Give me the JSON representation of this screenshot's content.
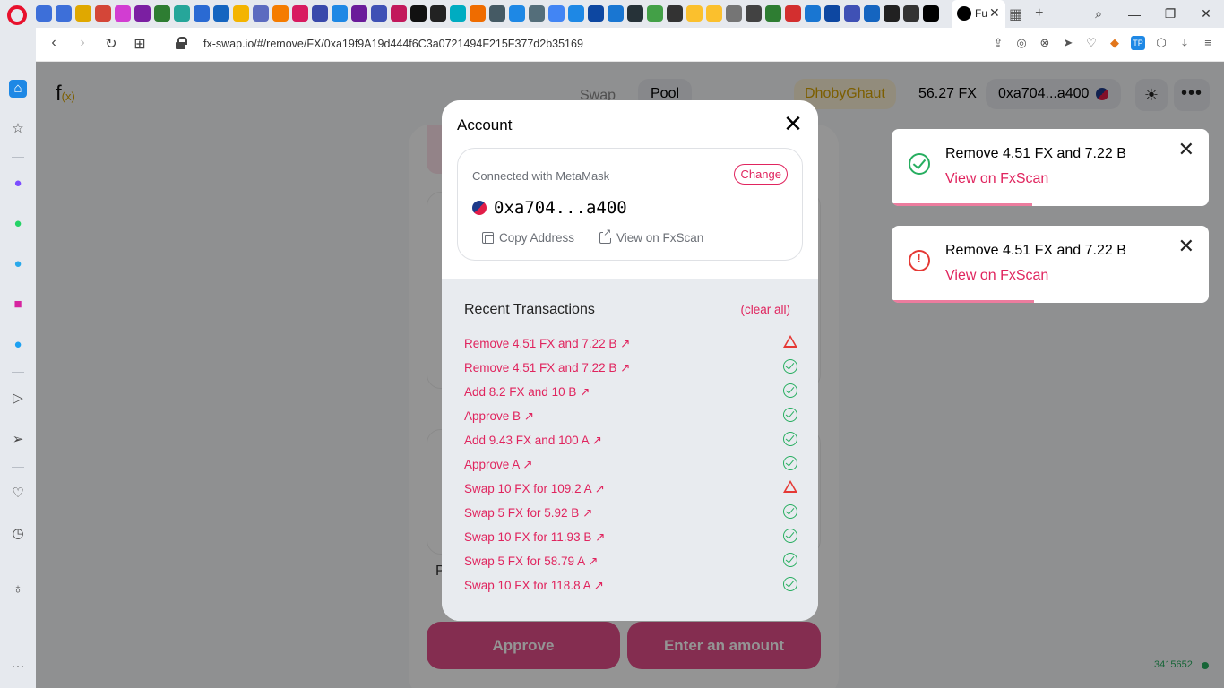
{
  "browser": {
    "active_tab_title": "Fu",
    "url": "fx-swap.io/#/remove/FX/0xa19f9A19d444f6C3a0721494F215F377d2b35169",
    "tab_favicon_colors": [
      "#3d6fd9",
      "#3d6fd9",
      "#e0a800",
      "#d44638",
      "#d23dd2",
      "#7b1fa2",
      "#2e7d32",
      "#26a69a",
      "#2a6ad3",
      "#1565c0",
      "#f4b400",
      "#5c6bc0",
      "#f57c00",
      "#d81b60",
      "#3949ab",
      "#1e88e5",
      "#6a1b9a",
      "#3f51b5",
      "#c2185b",
      "#111111",
      "#222222",
      "#00acc1",
      "#ef6c00",
      "#455a64",
      "#1e88e5",
      "#546e7a",
      "#4285f4",
      "#1e88e5",
      "#0d47a1",
      "#1976d2",
      "#263238",
      "#43a047",
      "#333333",
      "#fbc02d",
      "#fbc02d",
      "#757575",
      "#424242",
      "#2e7d32",
      "#d32f2f",
      "#1976d2",
      "#0d47a1",
      "#3f51b5",
      "#1565c0",
      "#212121",
      "#333333",
      "#000000"
    ]
  },
  "app": {
    "logo_text": "f",
    "logo_sub": "(x)",
    "nav": {
      "swap": "Swap",
      "pool": "Pool"
    },
    "network": "DhobyGhaut",
    "balance": "56.27 FX",
    "account_short": "0xa704...a400"
  },
  "background": {
    "approve_label": "Approve",
    "enter_amount_label": "Enter an amount",
    "p_letter": "P",
    "block_number": "3415652"
  },
  "toasts": [
    {
      "message": "Remove 4.51 FX and 7.22 B",
      "link": "View on FxScan",
      "status": "success"
    },
    {
      "message": "Remove 4.51 FX and 7.22 B",
      "link": "View on FxScan",
      "status": "error"
    }
  ],
  "modal": {
    "title": "Account",
    "connected_with": "Connected with MetaMask",
    "change_label": "Change",
    "address": "0xa704...a400",
    "copy_address": "Copy Address",
    "view_on_fxscan": "View on FxScan",
    "recent_title": "Recent Transactions",
    "clear_all": "(clear all)",
    "transactions": [
      {
        "label": "Remove 4.51 FX and 7.22 B ↗",
        "status": "warn"
      },
      {
        "label": "Remove 4.51 FX and 7.22 B ↗",
        "status": "ok"
      },
      {
        "label": "Add 8.2 FX and 10 B ↗",
        "status": "ok"
      },
      {
        "label": "Approve B ↗",
        "status": "ok"
      },
      {
        "label": "Add 9.43 FX and 100 A ↗",
        "status": "ok"
      },
      {
        "label": "Approve A ↗",
        "status": "ok"
      },
      {
        "label": "Swap 10 FX for 109.2 A ↗",
        "status": "warn"
      },
      {
        "label": "Swap 5 FX for 5.92 B ↗",
        "status": "ok"
      },
      {
        "label": "Swap 10 FX for 11.93 B ↗",
        "status": "ok"
      },
      {
        "label": "Swap 5 FX for 58.79 A ↗",
        "status": "ok"
      },
      {
        "label": "Swap 10 FX for 118.8 A ↗",
        "status": "ok"
      }
    ]
  }
}
